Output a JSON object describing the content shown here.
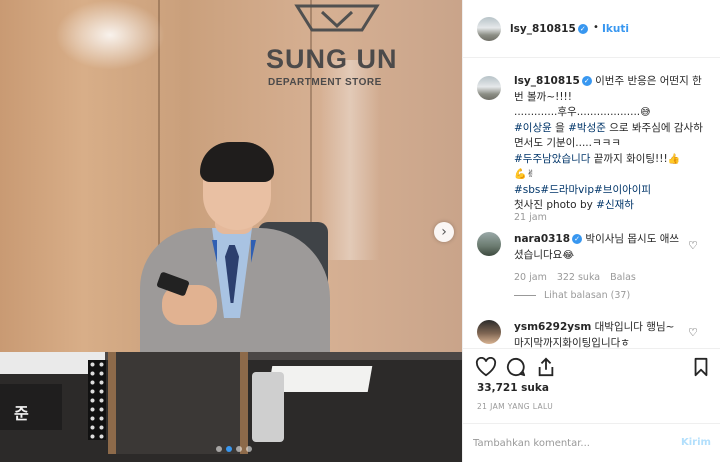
{
  "photo": {
    "sign_title": "SUNG UN",
    "sign_subtitle": "DEPARTMENT STORE",
    "nameplate_char": "준",
    "carousel_total": 4,
    "carousel_active_index": 1
  },
  "header": {
    "username": "lsy_810815",
    "separator": "•",
    "follow_label": "Ikuti"
  },
  "caption": {
    "username": "lsy_810815",
    "line1_text": "이번주 반응은 어떤지 한 번 볼까~!!!!",
    "line2_text": ".............후우...................",
    "line2_emoji": "😅",
    "tag1": "#이상윤",
    "tag1_suffix": " 을 ",
    "tag2": "#박성준",
    "line3_text": " 으로 봐주심에 감사하면서도 기분이.....ㅋㅋㅋ",
    "tag3": "#두주남았습니다",
    "line4_text": " 끝까지 화이팅!!!",
    "line4_emoji": "👍",
    "line5_emoji": "💪✌",
    "tag4": "#sbs",
    "tag5": "#드라마vip",
    "tag6": "#브이아이피",
    "line7_text": "첫사진 photo by ",
    "tag7": "#신재하",
    "time": "21 jam"
  },
  "comments": [
    {
      "username": "nara0318",
      "text": "박이사님 몹시도 애쓰셨습니다요",
      "emoji": "😂",
      "time": "20 jam",
      "likes": "322 suka",
      "reply_label": "Balas",
      "view_replies": "Lihat balasan (37)"
    },
    {
      "username": "ysm6292ysm",
      "text": "대박입니다 행님~ 마지막까지화이팅입니다ㅎ"
    }
  ],
  "actions": {
    "like_icon": "heart-outline",
    "comment_icon": "speech-bubble",
    "share_icon": "share-arrow",
    "save_icon": "bookmark"
  },
  "likes_count": "33,721 suka",
  "posted_time": "21 JAM YANG LALU",
  "add_comment": {
    "placeholder": "Tambahkan komentar...",
    "post_label": "Kirim"
  },
  "colors": {
    "accent": "#3897f0",
    "hashtag": "#003569",
    "muted": "#999999",
    "post_disabled": "#b2dffc"
  }
}
